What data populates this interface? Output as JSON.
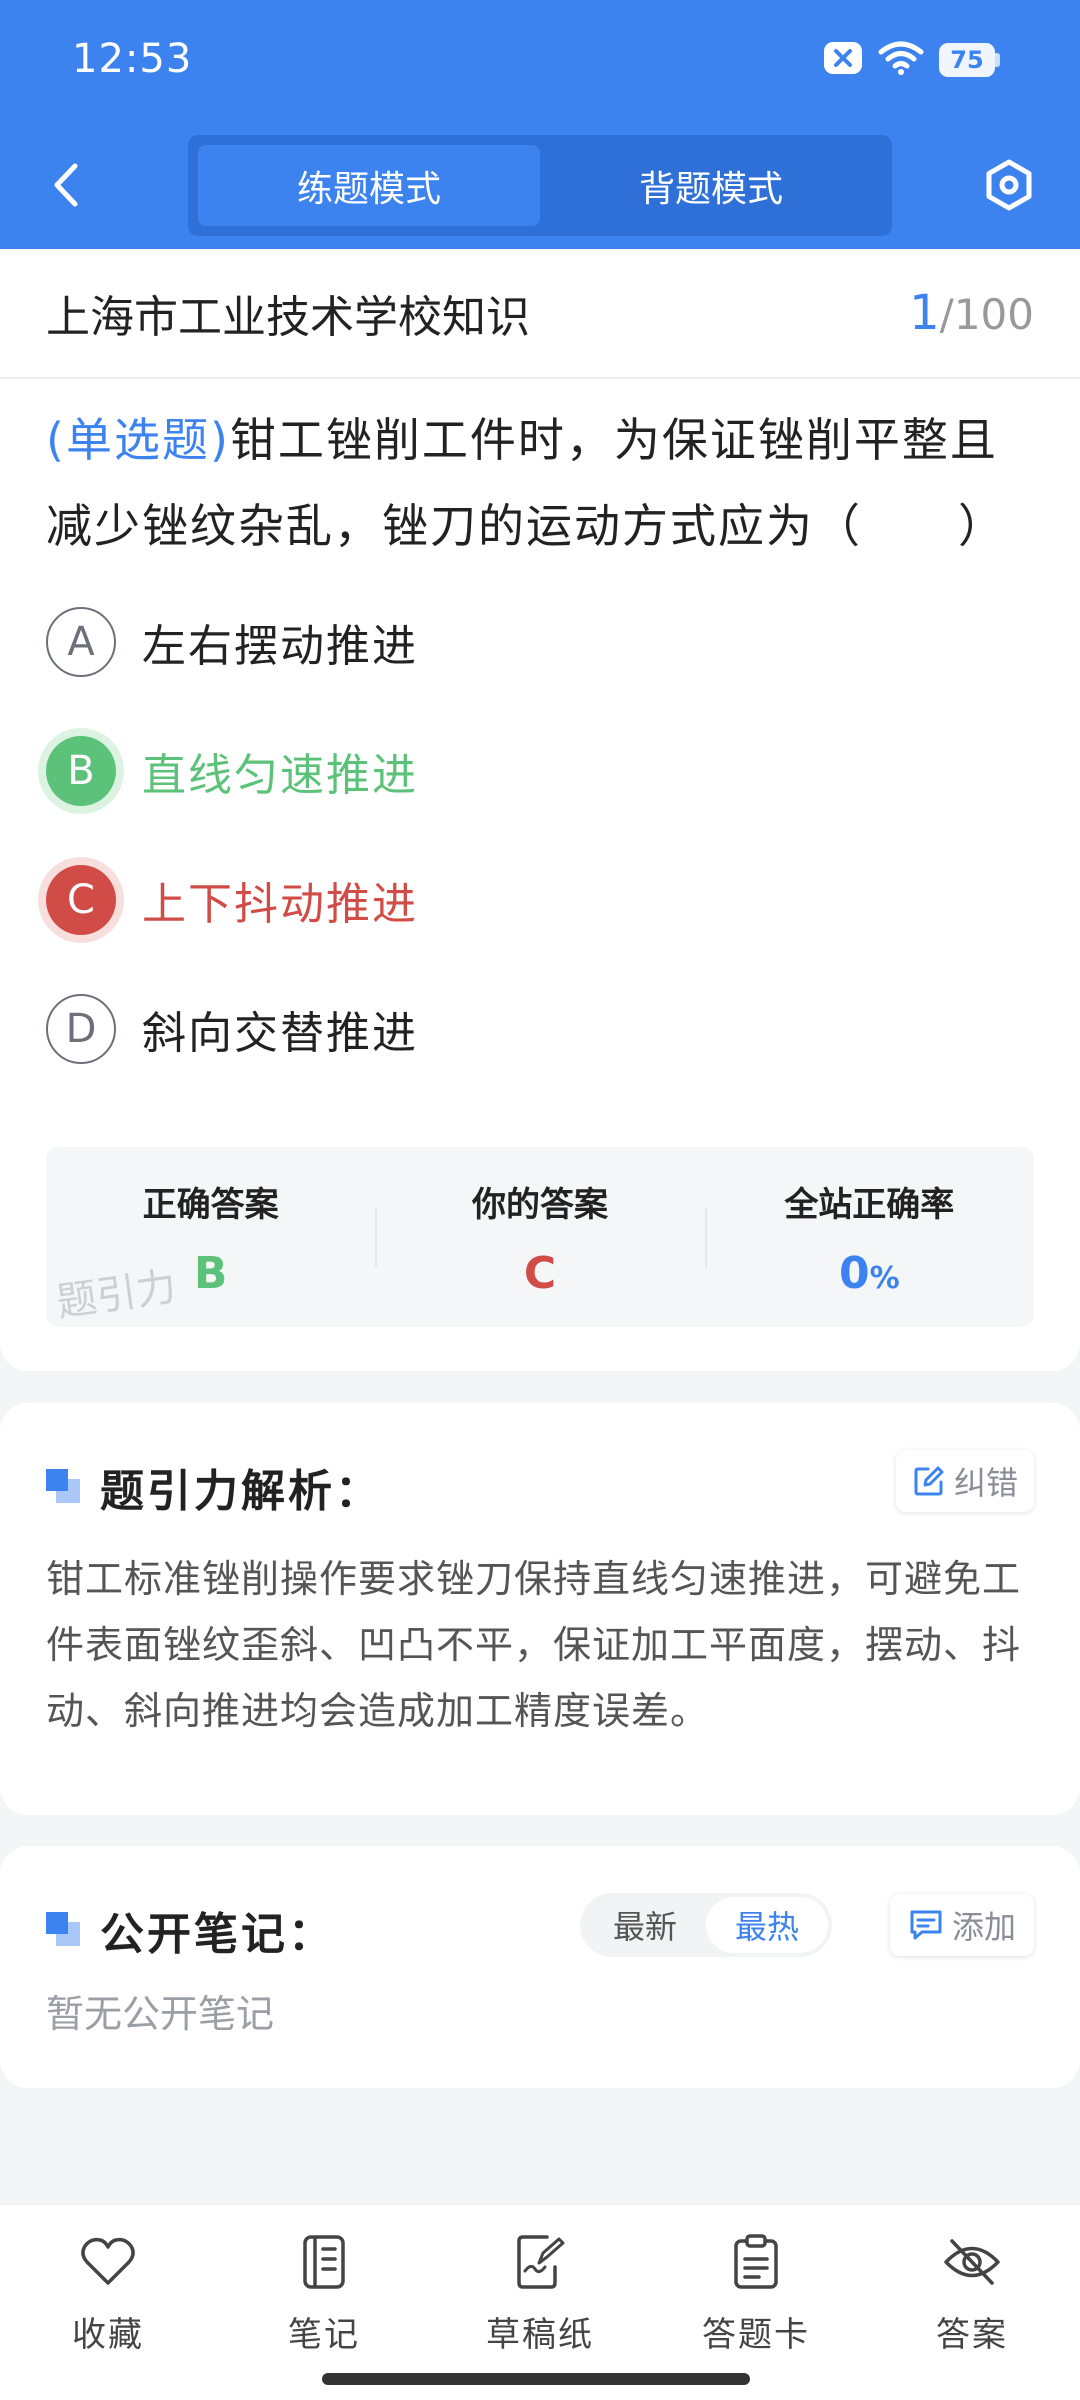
{
  "status_bar": {
    "time": "12:53",
    "battery": "75"
  },
  "header": {
    "modes": [
      "练题模式",
      "背题模式"
    ],
    "active_mode": "练题模式"
  },
  "question_card": {
    "subject": "上海市工业技术学校知识",
    "progress_current": "1",
    "progress_total": "/100",
    "type_label": "(单选题)",
    "stem": "钳工锉削工件时，为保证锉削平整且减少锉纹杂乱，锉刀的运动方式应为（　　）",
    "options": [
      {
        "letter": "A",
        "text": "左右摆动推进",
        "state": "normal"
      },
      {
        "letter": "B",
        "text": "直线匀速推进",
        "state": "correct"
      },
      {
        "letter": "C",
        "text": "上下抖动推进",
        "state": "wrong"
      },
      {
        "letter": "D",
        "text": "斜向交替推进",
        "state": "normal"
      }
    ],
    "answer_summary": {
      "correct_label": "正确答案",
      "correct_value": "B",
      "yours_label": "你的答案",
      "yours_value": "C",
      "rate_label": "全站正确率",
      "rate_value": "0",
      "rate_unit": "%"
    },
    "watermark": "题引力"
  },
  "analysis": {
    "title": "题引力解析：",
    "correct_button": "纠错",
    "text": "钳工标准锉削操作要求锉刀保持直线匀速推进，可避免工件表面锉纹歪斜、凹凸不平，保证加工平面度，摆动、抖动、斜向推进均会造成加工精度误差。"
  },
  "notes": {
    "title": "公开笔记：",
    "sort_options": [
      "最新",
      "最热"
    ],
    "active_sort": "最热",
    "add_button": "添加",
    "empty_text": "暂无公开笔记"
  },
  "bottom_nav": [
    "收藏",
    "笔记",
    "草稿纸",
    "答题卡",
    "答案"
  ],
  "colors": {
    "primary": "#3d83f0",
    "correct": "#5cc27a",
    "wrong": "#d24c47"
  }
}
